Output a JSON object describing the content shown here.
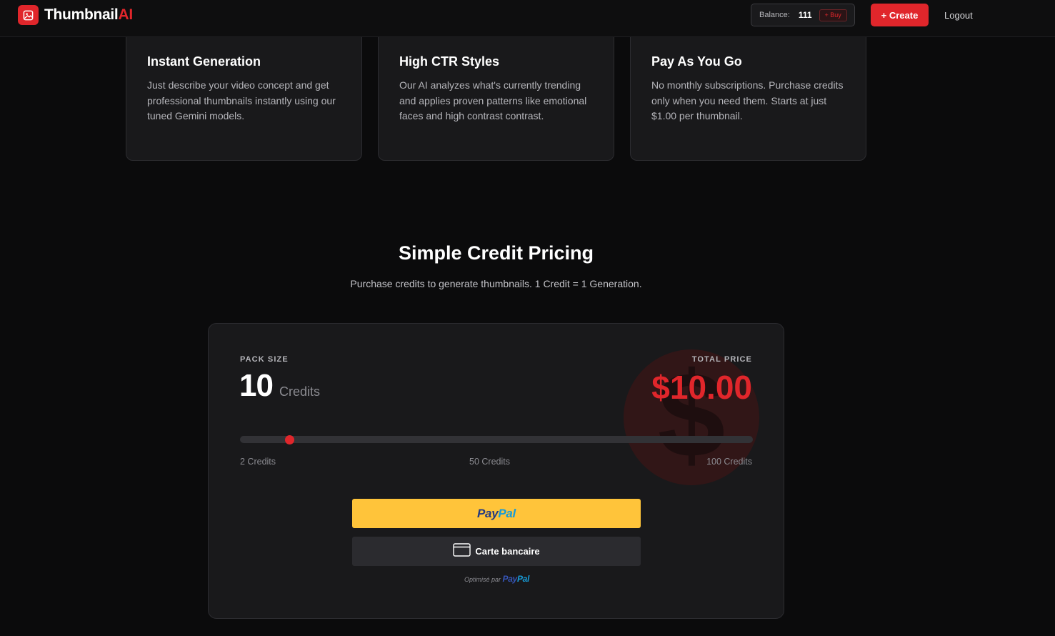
{
  "header": {
    "logo_main": "Thumbnail",
    "logo_accent": "AI",
    "balance_label": "Balance:",
    "balance_value": "111",
    "buy_label": "+ Buy",
    "create_label": "+ Create",
    "logout_label": "Logout"
  },
  "features": [
    {
      "title": "Instant Generation",
      "description": "Just describe your video concept and get professional thumbnails instantly using our tuned Gemini models."
    },
    {
      "title": "High CTR Styles",
      "description": "Our AI analyzes what's currently trending and applies proven patterns like emotional faces and high contrast contrast."
    },
    {
      "title": "Pay As You Go",
      "description": "No monthly subscriptions. Purchase credits only when you need them. Starts at just $1.00 per thumbnail."
    }
  ],
  "pricing": {
    "title": "Simple Credit Pricing",
    "subtitle": "Purchase credits to generate thumbnails. 1 Credit = 1 Generation.",
    "pack_label": "PACK SIZE",
    "pack_value": "10",
    "pack_unit": "Credits",
    "total_label": "TOTAL PRICE",
    "total_value": "$10.00",
    "slider": {
      "min": 2,
      "max": 100,
      "value": 10
    },
    "ticks": [
      "2 Credits",
      "50 Credits",
      "100 Credits"
    ],
    "paypal_part1": "Pay",
    "paypal_part2": "Pal",
    "card_label": "Carte bancaire",
    "powered_prefix": "Optimisé par"
  },
  "colors": {
    "accent": "#e0262b",
    "paypal_yellow": "#ffc43a",
    "background": "#0b0b0c",
    "card": "#19191b"
  },
  "icons": [
    "image-icon",
    "credit-card-icon",
    "dollar-icon"
  ]
}
